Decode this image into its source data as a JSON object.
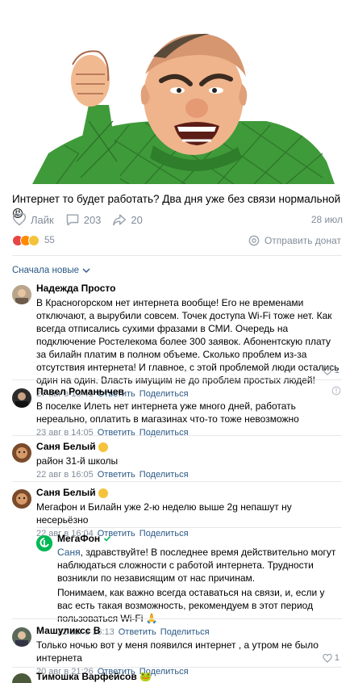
{
  "post": {
    "text": "Интернет то будет работать? Два дня уже без связи нормальной 😡",
    "like_label": "Лайк",
    "comments_count": "203",
    "shares_count": "20",
    "date": "28 июл",
    "reactions_count": "55",
    "gift_label": "Отправить донат",
    "reaction_colors": [
      "#e64646",
      "#ff8a00",
      "#f5c33b"
    ]
  },
  "sort": {
    "label": "Сначала новые"
  },
  "comments": [
    {
      "author": "Надежда Просто",
      "text": "В Красногорском нет интернета вообще! Его не временами отключают, а вырубили совсем. Точек доступа Wi-Fi тоже нет. Как всегда отписались сухими фразами в СМИ. Очередь на подключение Ростелекома более 300 заявок. Абонентскую плату за билайн платим в полном объеме. Сколько проблем из-за отсутствия интернета! И главное, с этой проблемой люди остались один на один. Власть имущим не до проблем простых людей!",
      "date": "27 авг в 13:41",
      "reply_label": "Ответить",
      "share_label": "Поделиться",
      "likes": "1"
    },
    {
      "author": "Павел Романычев",
      "text": "В поселке Илеть нет интернета уже много дней, работать нереально, оплатить в магазинах что-то тоже невозможно",
      "date": "23 авг в 14:05",
      "reply_label": "Ответить",
      "share_label": "Поделиться",
      "likes": ""
    },
    {
      "author": "Саня Белый",
      "text": "район 31-й школы",
      "date": "22 авг в 16:05",
      "reply_label": "Ответить",
      "share_label": "Поделиться",
      "likes": ""
    },
    {
      "author": "Саня Белый",
      "text": "Мегафон и Билайн уже 2-ю неделю выше 2g непашут ну несерьёзно",
      "date": "22 авг в 16:04",
      "reply_label": "Ответить",
      "share_label": "Поделиться",
      "likes": ""
    },
    {
      "author": "Машуликсс В",
      "text": "Только ночью вот у меня появился интернет , а утром не было интернета",
      "date": "20 авг в 21:26",
      "reply_label": "Ответить",
      "share_label": "Поделиться",
      "likes": "1"
    },
    {
      "author": "Тимошка Варфейсов 🐸",
      "text": "",
      "date": "",
      "reply_label": "",
      "share_label": "",
      "likes": ""
    }
  ],
  "reply": {
    "author": "МегаФон",
    "mention": "Саня",
    "text1": ", здравствуйте! В последнее время действительно могут наблюдаться сложности с работой интернета. Трудности возникли по независящим от нас причинам.",
    "text2": "Понимаем, как важно всегда оставаться на связи, и, если у вас есть такая возможность, рекомендуем в этот период пользоваться Wi-Fi 🙏",
    "date": "22 авг в 16:13",
    "reply_label": "Ответить",
    "share_label": "Поделиться",
    "brand_color": "#00b956"
  },
  "colors": {
    "link": "#2a5885",
    "muted": "#818c99",
    "divider": "#e7e8ec"
  }
}
